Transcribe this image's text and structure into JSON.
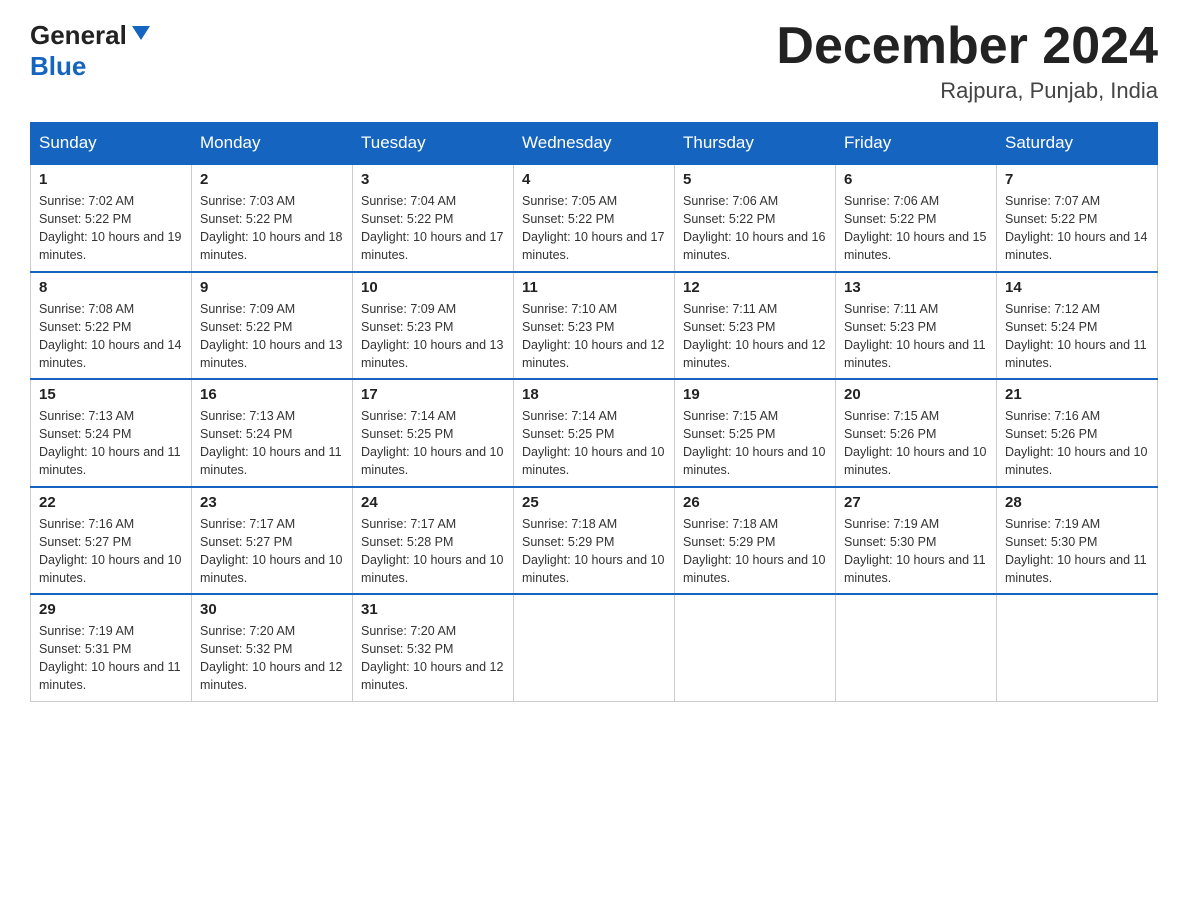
{
  "header": {
    "logo_line1": "General",
    "logo_line2": "Blue",
    "month_title": "December 2024",
    "location": "Rajpura, Punjab, India"
  },
  "days_of_week": [
    "Sunday",
    "Monday",
    "Tuesday",
    "Wednesday",
    "Thursday",
    "Friday",
    "Saturday"
  ],
  "weeks": [
    [
      {
        "day": "1",
        "sunrise": "7:02 AM",
        "sunset": "5:22 PM",
        "daylight": "10 hours and 19 minutes."
      },
      {
        "day": "2",
        "sunrise": "7:03 AM",
        "sunset": "5:22 PM",
        "daylight": "10 hours and 18 minutes."
      },
      {
        "day": "3",
        "sunrise": "7:04 AM",
        "sunset": "5:22 PM",
        "daylight": "10 hours and 17 minutes."
      },
      {
        "day": "4",
        "sunrise": "7:05 AM",
        "sunset": "5:22 PM",
        "daylight": "10 hours and 17 minutes."
      },
      {
        "day": "5",
        "sunrise": "7:06 AM",
        "sunset": "5:22 PM",
        "daylight": "10 hours and 16 minutes."
      },
      {
        "day": "6",
        "sunrise": "7:06 AM",
        "sunset": "5:22 PM",
        "daylight": "10 hours and 15 minutes."
      },
      {
        "day": "7",
        "sunrise": "7:07 AM",
        "sunset": "5:22 PM",
        "daylight": "10 hours and 14 minutes."
      }
    ],
    [
      {
        "day": "8",
        "sunrise": "7:08 AM",
        "sunset": "5:22 PM",
        "daylight": "10 hours and 14 minutes."
      },
      {
        "day": "9",
        "sunrise": "7:09 AM",
        "sunset": "5:22 PM",
        "daylight": "10 hours and 13 minutes."
      },
      {
        "day": "10",
        "sunrise": "7:09 AM",
        "sunset": "5:23 PM",
        "daylight": "10 hours and 13 minutes."
      },
      {
        "day": "11",
        "sunrise": "7:10 AM",
        "sunset": "5:23 PM",
        "daylight": "10 hours and 12 minutes."
      },
      {
        "day": "12",
        "sunrise": "7:11 AM",
        "sunset": "5:23 PM",
        "daylight": "10 hours and 12 minutes."
      },
      {
        "day": "13",
        "sunrise": "7:11 AM",
        "sunset": "5:23 PM",
        "daylight": "10 hours and 11 minutes."
      },
      {
        "day": "14",
        "sunrise": "7:12 AM",
        "sunset": "5:24 PM",
        "daylight": "10 hours and 11 minutes."
      }
    ],
    [
      {
        "day": "15",
        "sunrise": "7:13 AM",
        "sunset": "5:24 PM",
        "daylight": "10 hours and 11 minutes."
      },
      {
        "day": "16",
        "sunrise": "7:13 AM",
        "sunset": "5:24 PM",
        "daylight": "10 hours and 11 minutes."
      },
      {
        "day": "17",
        "sunrise": "7:14 AM",
        "sunset": "5:25 PM",
        "daylight": "10 hours and 10 minutes."
      },
      {
        "day": "18",
        "sunrise": "7:14 AM",
        "sunset": "5:25 PM",
        "daylight": "10 hours and 10 minutes."
      },
      {
        "day": "19",
        "sunrise": "7:15 AM",
        "sunset": "5:25 PM",
        "daylight": "10 hours and 10 minutes."
      },
      {
        "day": "20",
        "sunrise": "7:15 AM",
        "sunset": "5:26 PM",
        "daylight": "10 hours and 10 minutes."
      },
      {
        "day": "21",
        "sunrise": "7:16 AM",
        "sunset": "5:26 PM",
        "daylight": "10 hours and 10 minutes."
      }
    ],
    [
      {
        "day": "22",
        "sunrise": "7:16 AM",
        "sunset": "5:27 PM",
        "daylight": "10 hours and 10 minutes."
      },
      {
        "day": "23",
        "sunrise": "7:17 AM",
        "sunset": "5:27 PM",
        "daylight": "10 hours and 10 minutes."
      },
      {
        "day": "24",
        "sunrise": "7:17 AM",
        "sunset": "5:28 PM",
        "daylight": "10 hours and 10 minutes."
      },
      {
        "day": "25",
        "sunrise": "7:18 AM",
        "sunset": "5:29 PM",
        "daylight": "10 hours and 10 minutes."
      },
      {
        "day": "26",
        "sunrise": "7:18 AM",
        "sunset": "5:29 PM",
        "daylight": "10 hours and 10 minutes."
      },
      {
        "day": "27",
        "sunrise": "7:19 AM",
        "sunset": "5:30 PM",
        "daylight": "10 hours and 11 minutes."
      },
      {
        "day": "28",
        "sunrise": "7:19 AM",
        "sunset": "5:30 PM",
        "daylight": "10 hours and 11 minutes."
      }
    ],
    [
      {
        "day": "29",
        "sunrise": "7:19 AM",
        "sunset": "5:31 PM",
        "daylight": "10 hours and 11 minutes."
      },
      {
        "day": "30",
        "sunrise": "7:20 AM",
        "sunset": "5:32 PM",
        "daylight": "10 hours and 12 minutes."
      },
      {
        "day": "31",
        "sunrise": "7:20 AM",
        "sunset": "5:32 PM",
        "daylight": "10 hours and 12 minutes."
      },
      null,
      null,
      null,
      null
    ]
  ]
}
